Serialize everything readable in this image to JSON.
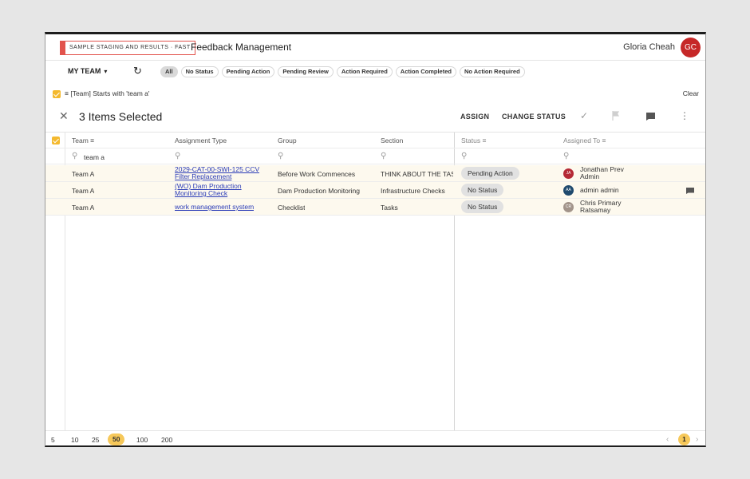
{
  "header": {
    "brand": "SAMPLE STAGING AND RESULTS · FAST",
    "title": "Feedback Management",
    "user_name": "Gloria Cheah",
    "user_initials": "GC"
  },
  "filters": {
    "team_label": "MY TEAM",
    "chips": [
      "All",
      "No Status",
      "Pending Action",
      "Pending Review",
      "Action Required",
      "Action Completed",
      "No Action Required"
    ],
    "active_chip": "All",
    "applied_filter": "[Team] Starts with 'team a'",
    "clear_label": "Clear"
  },
  "selection": {
    "title": "3 Items Selected",
    "assign_label": "ASSIGN",
    "change_status_label": "CHANGE STATUS"
  },
  "table": {
    "columns": [
      "Team",
      "Assignment Type",
      "Group",
      "Section",
      "Status",
      "Assigned To"
    ],
    "search_value": "team a",
    "rows": [
      {
        "team": "Team A",
        "assignment_type": "2029-CAT-00-SWI-125 CCV Filter Replacement",
        "assignment_line1": "2029-CAT-00-SWI-125 CCV",
        "assignment_line2": "Filter Replacement",
        "group": "Before Work Commences",
        "section": "THINK ABOUT THE TASK",
        "status": "Pending Action",
        "assignee_initials": "JA",
        "assignee_line1": "Jonathan Prev",
        "assignee_line2": "Admin"
      },
      {
        "team": "Team A",
        "assignment_type": "(WO) Dam Production Monitoring Check",
        "assignment_line1": "(WO) Dam Production",
        "assignment_line2": "Monitoring Check",
        "group": "Dam Production Monitoring",
        "section": "Infrastructure Checks",
        "status": "No Status",
        "assignee_initials": "AA",
        "assignee_line1": "admin admin",
        "assignee_line2": ""
      },
      {
        "team": "Team A",
        "assignment_type": "work management system",
        "assignment_line1": "work management system",
        "assignment_line2": "",
        "group": "Checklist",
        "section": "Tasks",
        "status": "No Status",
        "assignee_initials": "CR",
        "assignee_line1": "Chris Primary",
        "assignee_line2": "Ratsamay"
      }
    ]
  },
  "footer": {
    "page_sizes": [
      "5",
      "10",
      "25",
      "50",
      "100",
      "200"
    ],
    "active_page_size": "50",
    "current_page": "1"
  },
  "colors": {
    "accent": "#f6c85a",
    "brand": "#e2534c",
    "link": "#2a3bb7",
    "user_avatar": "#c62828"
  }
}
